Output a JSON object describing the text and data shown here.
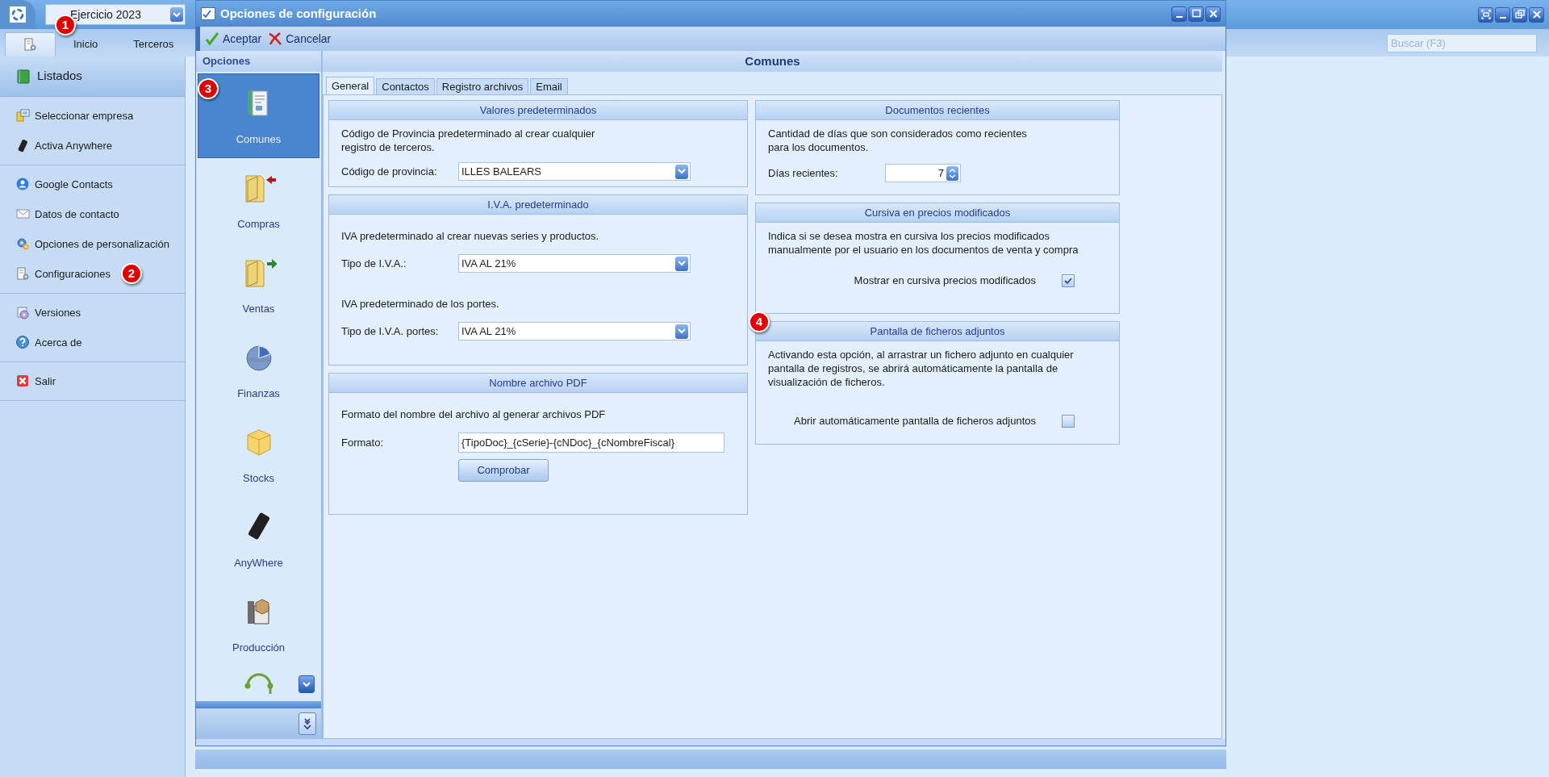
{
  "app": {
    "fiscal_year": "Ejercicio 2023",
    "search": {
      "placeholder": "Buscar (F3)"
    }
  },
  "ribbon_tabs": [
    {
      "kind": "icon",
      "selected": true,
      "marker": "1"
    },
    {
      "kind": "text",
      "label": "Inicio",
      "selected": false
    },
    {
      "kind": "text",
      "label": "Terceros",
      "selected": false
    }
  ],
  "sidebar": {
    "header": "Listados",
    "sections": [
      [
        {
          "kind": "company",
          "label": "Seleccionar empresa"
        },
        {
          "kind": "phone",
          "label": "Activa Anywhere"
        }
      ],
      [
        {
          "kind": "contact",
          "label": "Google Contacts"
        },
        {
          "kind": "mail",
          "label": "Datos de contacto"
        },
        {
          "kind": "gears",
          "label": "Opciones de personalización"
        },
        {
          "kind": "config",
          "label": "Configuraciones",
          "marker": "2"
        }
      ],
      [
        {
          "kind": "versions",
          "label": "Versiones"
        },
        {
          "kind": "help",
          "label": "Acerca de"
        }
      ],
      [
        {
          "kind": "exit",
          "label": "Salir"
        }
      ]
    ]
  },
  "dialog": {
    "title": "Opciones de configuración",
    "toolbar": [
      {
        "kind": "accept",
        "label": "Aceptar"
      },
      {
        "kind": "cancel",
        "label": "Cancelar"
      }
    ],
    "options_header": "Opciones",
    "options": [
      {
        "kind": "documents",
        "label": "Comunes",
        "selected": true,
        "marker": "3"
      },
      {
        "kind": "purchases",
        "label": "Compras",
        "selected": false
      },
      {
        "kind": "sales",
        "label": "Ventas",
        "selected": false
      },
      {
        "kind": "finance",
        "label": "Finanzas",
        "selected": false
      },
      {
        "kind": "stocks",
        "label": "Stocks",
        "selected": false
      },
      {
        "kind": "mobile",
        "label": "AnyWhere",
        "selected": false
      },
      {
        "kind": "production",
        "label": "Producción",
        "selected": false
      },
      {
        "kind": "network",
        "selected": false
      }
    ],
    "section_title": "Comunes",
    "tabs": [
      {
        "label": "General",
        "selected": true
      },
      {
        "label": "Contactos",
        "selected": false
      },
      {
        "label": "Registro archivos",
        "selected": false
      },
      {
        "label": "Email",
        "selected": false
      }
    ],
    "left_groups": [
      {
        "title": "Valores predeterminados",
        "rows": [
          {
            "kind": "text",
            "text": "Código de Provincia predeterminado al crear cualquier\nregistro de terceros."
          },
          {
            "kind": "select",
            "label": "Código de provincia:",
            "value": "ILLES BALEARS"
          }
        ]
      },
      {
        "title": "I.V.A. predeterminado",
        "rows": [
          {
            "kind": "text",
            "text": "IVA predeterminado al crear nuevas series y productos."
          },
          {
            "kind": "select",
            "label": "Tipo de I.V.A.:",
            "value": "IVA AL 21%"
          },
          {
            "kind": "text",
            "text": "IVA predeterminado de los portes."
          },
          {
            "kind": "select",
            "label": "Tipo de I.V.A. portes:",
            "value": "IVA AL 21%"
          }
        ]
      },
      {
        "title": "Nombre archivo PDF",
        "rows": [
          {
            "kind": "text",
            "text": "Formato del nombre del archivo al generar archivos PDF"
          },
          {
            "kind": "input",
            "label": "Formato:",
            "value": "{TipoDoc}_{cSerie}-{cNDoc}_{cNombreFiscal}"
          },
          {
            "kind": "button",
            "label": "Comprobar"
          }
        ]
      }
    ],
    "right_groups": [
      {
        "title": "Documentos recientes",
        "rows": [
          {
            "kind": "text",
            "text": "Cantidad de días que son considerados como recientes\npara los documentos."
          },
          {
            "kind": "spin",
            "label": "Días recientes:",
            "value": "7"
          }
        ]
      },
      {
        "title": "Cursiva en precios modificados",
        "rows": [
          {
            "kind": "text",
            "text": "Indica si se desea mostra en cursiva los precios modificados\nmanualmente por el usuario en los documentos de venta y compra"
          },
          {
            "kind": "checkbox",
            "label": "Mostrar en cursiva precios modificados",
            "checked": true
          }
        ]
      },
      {
        "title": "Pantalla de ficheros adjuntos",
        "marker": "4",
        "rows": [
          {
            "kind": "text",
            "text": "Activando esta opción, al arrastrar un fichero adjunto en cualquier\npantalla de registros, se abrirá automáticamente la pantalla de\nvisualización de ficheros."
          },
          {
            "kind": "checkbox",
            "label": "Abrir automáticamente pantalla de ficheros adjuntos",
            "checked": false
          }
        ]
      }
    ]
  }
}
